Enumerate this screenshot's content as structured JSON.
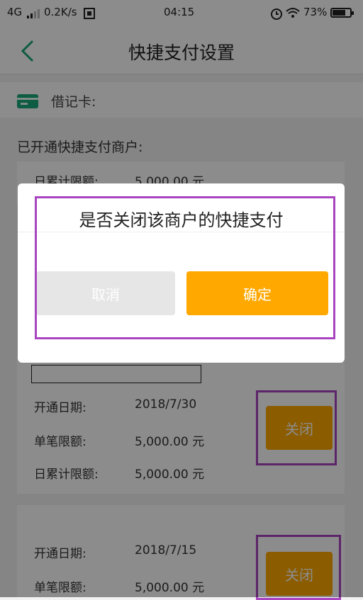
{
  "status_bar": {
    "network": "4G",
    "speed": "0.2K/s",
    "time": "04:15",
    "battery_percent": "73%",
    "battery_level": 0.73
  },
  "header": {
    "title": "快捷支付设置"
  },
  "card": {
    "label": "借记卡:"
  },
  "section": {
    "title": "已开通快捷支付商户:"
  },
  "merchants": [
    {
      "rows": [
        {
          "label": "日累计限额:",
          "value": "5,000.00 元"
        }
      ]
    },
    {
      "rows": [
        {
          "label": "开通日期:",
          "value": "2018/7/30"
        },
        {
          "label": "单笔限额:",
          "value": "5,000.00 元"
        },
        {
          "label": "日累计限额:",
          "value": "5,000.00 元"
        }
      ],
      "close_label": "关闭"
    },
    {
      "rows": [
        {
          "label": "开通日期:",
          "value": "2018/7/15"
        },
        {
          "label": "单笔限额:",
          "value": "5,000.00 元"
        }
      ],
      "close_label": "关闭"
    }
  ],
  "dialog": {
    "title": "是否关闭该商户的快捷支付",
    "cancel_label": "取消",
    "ok_label": "确定"
  },
  "colors": {
    "accent": "#ffa800",
    "highlight": "#a944c0",
    "card_icon": "#1aa87a"
  },
  "icons": [
    "signal-icon",
    "sim-icon",
    "alarm-icon",
    "wifi-icon",
    "battery-icon",
    "back-icon",
    "card-icon"
  ]
}
